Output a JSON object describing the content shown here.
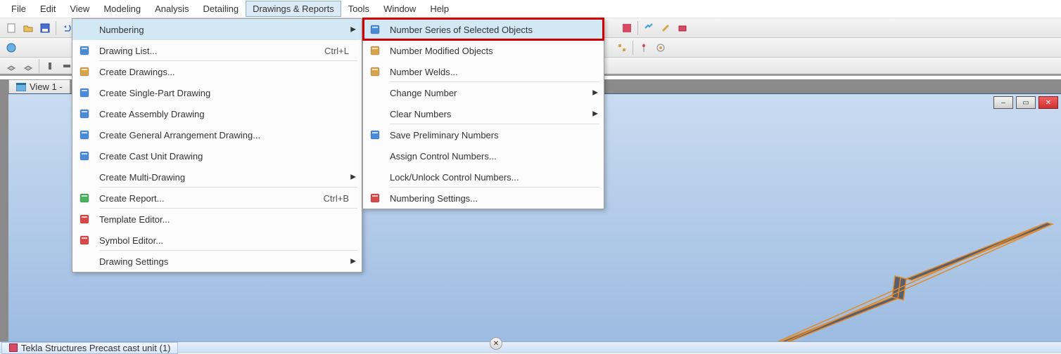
{
  "menubar": [
    "File",
    "Edit",
    "View",
    "Modeling",
    "Analysis",
    "Detailing",
    "Drawings & Reports",
    "Tools",
    "Window",
    "Help"
  ],
  "menubar_active_index": 6,
  "menu1": {
    "items": [
      {
        "label": "Numbering",
        "icon": "",
        "arrow": true,
        "highlight": true,
        "sep": true
      },
      {
        "label": "Drawing List...",
        "icon": "doc",
        "shortcut": "Ctrl+L",
        "sep": true
      },
      {
        "label": "Create Drawings...",
        "icon": "folder"
      },
      {
        "label": "Create Single-Part Drawing",
        "icon": "part"
      },
      {
        "label": "Create Assembly Drawing",
        "icon": "assembly"
      },
      {
        "label": "Create General Arrangement Drawing...",
        "icon": "ga"
      },
      {
        "label": "Create Cast Unit Drawing",
        "icon": "cast"
      },
      {
        "label": "Create Multi-Drawing",
        "icon": "",
        "arrow": true,
        "sep": true
      },
      {
        "label": "Create Report...",
        "icon": "report",
        "shortcut": "Ctrl+B",
        "sep": true
      },
      {
        "label": "Template Editor...",
        "icon": "template"
      },
      {
        "label": "Symbol Editor...",
        "icon": "symbol",
        "sep": true
      },
      {
        "label": "Drawing Settings",
        "icon": "",
        "arrow": true
      }
    ]
  },
  "menu2": {
    "items": [
      {
        "label": "Number Series of Selected Objects",
        "icon": "series",
        "highlight": true
      },
      {
        "label": "Number Modified Objects",
        "icon": "pencil"
      },
      {
        "label": "Number Welds...",
        "icon": "weld",
        "sep": true
      },
      {
        "label": "Change Number",
        "icon": "",
        "arrow": true
      },
      {
        "label": "Clear Numbers",
        "icon": "",
        "arrow": true,
        "sep": true
      },
      {
        "label": "Save Preliminary Numbers",
        "icon": "save"
      },
      {
        "label": "Assign Control Numbers...",
        "icon": ""
      },
      {
        "label": "Lock/Unlock Control Numbers...",
        "icon": "",
        "sep": true
      },
      {
        "label": "Numbering Settings...",
        "icon": "settings"
      }
    ]
  },
  "view_tab": "View 1 -",
  "taskbar_item": "Tekla Structures  Precast cast unit (1)",
  "icons": {
    "doc": "#4a8cd6",
    "folder": "#d6a44a",
    "part": "#4a8cd6",
    "assembly": "#4a8cd6",
    "ga": "#4a8cd6",
    "cast": "#4a8cd6",
    "report": "#4ab060",
    "template": "#d64a4a",
    "symbol": "#d64a4a",
    "series": "#4a8cd6",
    "pencil": "#d6a44a",
    "weld": "#d6a44a",
    "save": "#4a8cd6",
    "settings": "#d64a4a"
  }
}
